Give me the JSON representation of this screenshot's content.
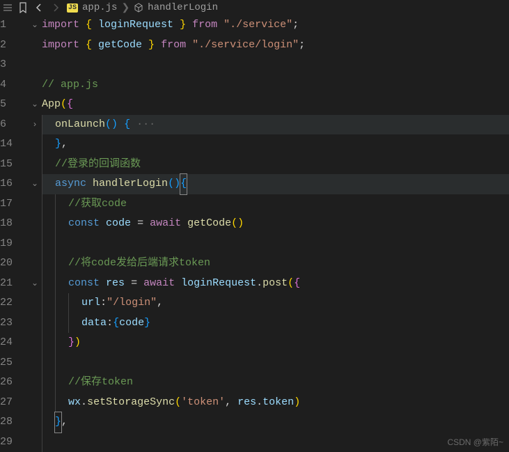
{
  "breadcrumb": {
    "file_badge": "JS",
    "file": "app.js",
    "symbol": "handlerLogin"
  },
  "lines": [
    {
      "num": "1",
      "fold": "v",
      "hl": false,
      "tokens": [
        [
          "keyword",
          "import "
        ],
        [
          "brace-y",
          "{ "
        ],
        [
          "ident",
          "loginRequest"
        ],
        [
          "brace-y",
          " }"
        ],
        [
          "keyword",
          " from "
        ],
        [
          "string",
          "\"./service\""
        ],
        [
          "punc",
          ";"
        ]
      ]
    },
    {
      "num": "2",
      "fold": "",
      "hl": false,
      "tokens": [
        [
          "keyword",
          "import "
        ],
        [
          "brace-y",
          "{ "
        ],
        [
          "ident",
          "getCode"
        ],
        [
          "brace-y",
          " }"
        ],
        [
          "keyword",
          " from "
        ],
        [
          "string",
          "\"./service/login\""
        ],
        [
          "punc",
          ";"
        ]
      ]
    },
    {
      "num": "3",
      "fold": "",
      "hl": false,
      "tokens": []
    },
    {
      "num": "4",
      "fold": "",
      "hl": false,
      "tokens": [
        [
          "comment",
          "// app.js"
        ]
      ]
    },
    {
      "num": "5",
      "fold": "v",
      "hl": false,
      "tokens": [
        [
          "func",
          "App"
        ],
        [
          "brace-y",
          "("
        ],
        [
          "brace-p",
          "{"
        ]
      ]
    },
    {
      "num": "6",
      "fold": ">",
      "hl": true,
      "indent": 1,
      "tokens": [
        [
          "func",
          "onLaunch"
        ],
        [
          "brace-b",
          "()"
        ],
        [
          "punc",
          " "
        ],
        [
          "brace-b",
          "{"
        ],
        [
          "ellipsis",
          " ···"
        ]
      ]
    },
    {
      "num": "14",
      "fold": "",
      "hl": false,
      "indent": 1,
      "tokens": [
        [
          "brace-b",
          "}"
        ],
        [
          "punc",
          ","
        ]
      ]
    },
    {
      "num": "15",
      "fold": "",
      "hl": false,
      "indent": 1,
      "tokens": [
        [
          "comment",
          "//登录的回调函数"
        ]
      ]
    },
    {
      "num": "16",
      "fold": "v",
      "hl": true,
      "indent": 1,
      "tokens": [
        [
          "keyword2",
          "async "
        ],
        [
          "func",
          "handlerLogin"
        ],
        [
          "brace-b",
          "()"
        ],
        [
          "brace-b-boxed",
          "{"
        ]
      ]
    },
    {
      "num": "17",
      "fold": "",
      "hl": false,
      "indent": 2,
      "tokens": [
        [
          "comment",
          "//获取code"
        ]
      ]
    },
    {
      "num": "18",
      "fold": "",
      "hl": false,
      "indent": 2,
      "tokens": [
        [
          "keyword2",
          "const "
        ],
        [
          "ident",
          "code"
        ],
        [
          "punc",
          " = "
        ],
        [
          "keyword",
          "await "
        ],
        [
          "func",
          "getCode"
        ],
        [
          "brace-y",
          "()"
        ]
      ]
    },
    {
      "num": "19",
      "fold": "",
      "hl": false,
      "indent": 2,
      "tokens": []
    },
    {
      "num": "20",
      "fold": "",
      "hl": false,
      "indent": 2,
      "tokens": [
        [
          "comment",
          "//将code发给后端请求token"
        ]
      ]
    },
    {
      "num": "21",
      "fold": "v",
      "hl": false,
      "indent": 2,
      "tokens": [
        [
          "keyword2",
          "const "
        ],
        [
          "ident",
          "res"
        ],
        [
          "punc",
          " = "
        ],
        [
          "keyword",
          "await "
        ],
        [
          "ident",
          "loginRequest"
        ],
        [
          "punc",
          "."
        ],
        [
          "func",
          "post"
        ],
        [
          "brace-y",
          "("
        ],
        [
          "brace-p",
          "{"
        ]
      ]
    },
    {
      "num": "22",
      "fold": "",
      "hl": false,
      "indent": 3,
      "tokens": [
        [
          "ident",
          "url"
        ],
        [
          "punc",
          ":"
        ],
        [
          "string",
          "\"/login\""
        ],
        [
          "punc",
          ","
        ]
      ]
    },
    {
      "num": "23",
      "fold": "",
      "hl": false,
      "indent": 3,
      "tokens": [
        [
          "ident",
          "data"
        ],
        [
          "punc",
          ":"
        ],
        [
          "brace-b",
          "{"
        ],
        [
          "ident",
          "code"
        ],
        [
          "brace-b",
          "}"
        ]
      ]
    },
    {
      "num": "24",
      "fold": "",
      "hl": false,
      "indent": 2,
      "tokens": [
        [
          "brace-p",
          "}"
        ],
        [
          "brace-y",
          ")"
        ]
      ]
    },
    {
      "num": "25",
      "fold": "",
      "hl": false,
      "indent": 2,
      "tokens": []
    },
    {
      "num": "26",
      "fold": "",
      "hl": false,
      "indent": 2,
      "tokens": [
        [
          "comment",
          "//保存token"
        ]
      ]
    },
    {
      "num": "27",
      "fold": "",
      "hl": false,
      "indent": 2,
      "tokens": [
        [
          "ident",
          "wx"
        ],
        [
          "punc",
          "."
        ],
        [
          "func",
          "setStorageSync"
        ],
        [
          "brace-y",
          "("
        ],
        [
          "string",
          "'token'"
        ],
        [
          "punc",
          ", "
        ],
        [
          "ident",
          "res"
        ],
        [
          "punc",
          "."
        ],
        [
          "ident",
          "token"
        ],
        [
          "brace-y",
          ")"
        ]
      ]
    },
    {
      "num": "28",
      "fold": "",
      "hl": false,
      "indent": 1,
      "tokens": [
        [
          "brace-b-boxed",
          "}"
        ],
        [
          "punc",
          ","
        ]
      ]
    },
    {
      "num": "29",
      "fold": "",
      "hl": false,
      "indent": 1,
      "tokens": []
    }
  ],
  "watermark": "CSDN @紫陌~"
}
